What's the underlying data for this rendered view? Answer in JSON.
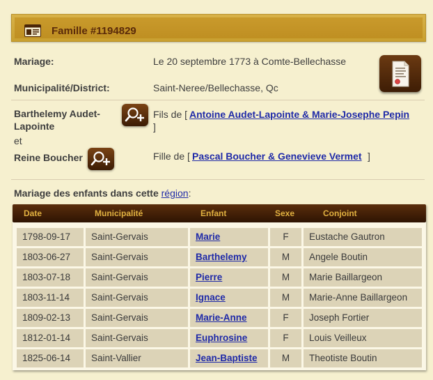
{
  "family": {
    "title": "Famille #1194829"
  },
  "marriage": {
    "label": "Mariage:",
    "value": "Le 20 septembre 1773 à Comte-Bellechasse",
    "municipality_label": "Municipalité/District:",
    "municipality_value": "Saint-Neree/Bellechasse, Qc"
  },
  "husband": {
    "name_line1": "Barthelemy Audet-",
    "name_line2": "Lapointe",
    "relation": "Fils de [",
    "parents": "Antoine Audet-Lapointe & Marie-Josephe Pepin",
    "close": "]"
  },
  "conjunction": "et",
  "wife": {
    "name": "Reine Boucher",
    "relation": "Fille de [",
    "parents": "Pascal Boucher & Genevieve Vermet",
    "close": "]"
  },
  "children_section": {
    "label": "Mariage des enfants dans cette",
    "link": "région",
    "suffix": ":"
  },
  "table": {
    "headers": {
      "date": "Date",
      "municipality": "Municipalité",
      "child": "Enfant",
      "sex": "Sexe",
      "spouse": "Conjoint"
    },
    "rows": [
      {
        "date": "1798-09-17",
        "municipality": "Saint-Gervais",
        "child": "Marie",
        "sex": "F",
        "spouse": "Eustache Gautron"
      },
      {
        "date": "1803-06-27",
        "municipality": "Saint-Gervais",
        "child": "Barthelemy",
        "sex": "M",
        "spouse": "Angele Boutin"
      },
      {
        "date": "1803-07-18",
        "municipality": "Saint-Gervais",
        "child": "Pierre",
        "sex": "M",
        "spouse": "Marie Baillargeon"
      },
      {
        "date": "1803-11-14",
        "municipality": "Saint-Gervais",
        "child": "Ignace",
        "sex": "M",
        "spouse": "Marie-Anne Baillargeon"
      },
      {
        "date": "1809-02-13",
        "municipality": "Saint-Gervais",
        "child": "Marie-Anne",
        "sex": "F",
        "spouse": "Joseph Fortier"
      },
      {
        "date": "1812-01-14",
        "municipality": "Saint-Gervais",
        "child": "Euphrosine",
        "sex": "F",
        "spouse": "Louis Veilleux"
      },
      {
        "date": "1825-06-14",
        "municipality": "Saint-Vallier",
        "child": "Jean-Baptiste",
        "sex": "M",
        "spouse": "Theotiste Boutin"
      }
    ]
  },
  "icons": {
    "family": "family-card-icon",
    "document": "certificate-document-icon",
    "add_person": "add-person-search-icon"
  },
  "colors": {
    "accent": "#c9a030",
    "header_text": "#5a2a0a",
    "link": "#1f2aa8",
    "table_header": "#2e1402"
  }
}
